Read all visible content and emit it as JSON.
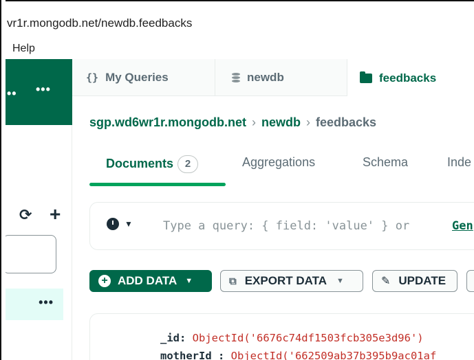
{
  "window": {
    "title": "vr1r.mongodb.net/newdb.feedbacks"
  },
  "menu": {
    "help": "Help"
  },
  "sidebar": {
    "dots_a": "••",
    "dots_b": "•••",
    "refresh_icon": "⟳",
    "add_icon": "+",
    "item_more": "•••"
  },
  "tabs": [
    {
      "icon": "{}",
      "label": "My Queries"
    },
    {
      "icon": "database",
      "label": "newdb"
    },
    {
      "icon": "folder",
      "label": "feedbacks"
    }
  ],
  "breadcrumb": [
    "sgp.wd6wr1r.mongodb.net",
    "newdb",
    "feedbacks"
  ],
  "subtabs": {
    "documents": "Documents",
    "documents_count": "2",
    "aggregations": "Aggregations",
    "schema": "Schema",
    "indexes": "Inde"
  },
  "query": {
    "placeholder": "Type a query: { field: 'value' } or",
    "generate": "Gen"
  },
  "toolbar": {
    "add_data": "ADD DATA",
    "export_data": "EXPORT DATA",
    "update": "UPDATE"
  },
  "document": {
    "id_key": "_id",
    "id_value": "ObjectId('6676c74df1503fcb305e3d96')",
    "mother_key": "motherId",
    "mother_value": "ObjectId('662509ab37b395b9ac01af"
  },
  "colors": {
    "brand": "#00684a",
    "accent": "#00a35c",
    "value": "#c22f27"
  }
}
